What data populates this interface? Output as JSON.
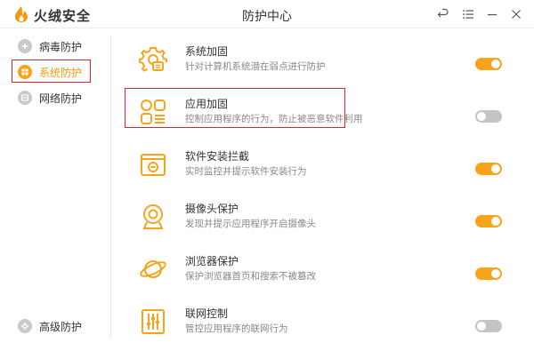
{
  "app": {
    "name": "火绒安全",
    "window_title": "防护中心"
  },
  "colors": {
    "accent": "#f7a41c",
    "highlight": "#e0222a",
    "toggle_off": "#c4c4c4"
  },
  "title_buttons": [
    {
      "name": "back-icon"
    },
    {
      "name": "menu-icon"
    },
    {
      "name": "minimize-icon"
    },
    {
      "name": "close-icon"
    }
  ],
  "sidebar": {
    "items": [
      {
        "label": "病毒防护",
        "icon": "plus-circle-icon",
        "active": false
      },
      {
        "label": "系统防护",
        "icon": "windows-icon",
        "active": true
      },
      {
        "label": "网络防护",
        "icon": "globe-icon",
        "active": false
      },
      {
        "label": "高级防护",
        "icon": "gear-icon",
        "active": false
      }
    ]
  },
  "features": [
    {
      "title": "系统加固",
      "desc": "针对计算机系统潜在弱点进行防护",
      "icon": "gear-shield-icon",
      "enabled": true
    },
    {
      "title": "应用加固",
      "desc": "控制应用程序的行为，防止被恶意软件利用",
      "icon": "app-grid-icon",
      "enabled": false
    },
    {
      "title": "软件安装拦截",
      "desc": "实时监控并提示软件安装行为",
      "icon": "install-box-icon",
      "enabled": true
    },
    {
      "title": "摄像头保护",
      "desc": "发现并提示应用程序开启摄像头",
      "icon": "webcam-icon",
      "enabled": true
    },
    {
      "title": "浏览器保护",
      "desc": "保护浏览器首页和搜索不被篡改",
      "icon": "planet-icon",
      "enabled": true
    },
    {
      "title": "联网控制",
      "desc": "管控应用程序的联网行为",
      "icon": "sliders-icon",
      "enabled": false
    }
  ]
}
